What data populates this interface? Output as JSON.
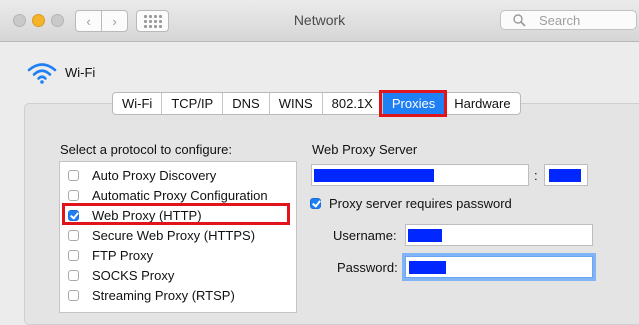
{
  "window": {
    "title": "Network",
    "search_placeholder": "Search"
  },
  "network": {
    "name": "Wi-Fi"
  },
  "tabs": [
    {
      "label": "Wi-Fi",
      "active": false
    },
    {
      "label": "TCP/IP",
      "active": false
    },
    {
      "label": "DNS",
      "active": false
    },
    {
      "label": "WINS",
      "active": false
    },
    {
      "label": "802.1X",
      "active": false
    },
    {
      "label": "Proxies",
      "active": true
    },
    {
      "label": "Hardware",
      "active": false
    }
  ],
  "protocols": {
    "heading": "Select a protocol to configure:",
    "items": [
      {
        "label": "Auto Proxy Discovery",
        "checked": false
      },
      {
        "label": "Automatic Proxy Configuration",
        "checked": false
      },
      {
        "label": "Web Proxy (HTTP)",
        "checked": true,
        "highlighted": true
      },
      {
        "label": "Secure Web Proxy (HTTPS)",
        "checked": false
      },
      {
        "label": "FTP Proxy",
        "checked": false
      },
      {
        "label": "SOCKS Proxy",
        "checked": false
      },
      {
        "label": "Streaming Proxy (RTSP)",
        "checked": false
      }
    ]
  },
  "server": {
    "heading": "Web Proxy Server",
    "colon": ":",
    "requires_password_label": "Proxy server requires password",
    "requires_password": true,
    "username_label": "Username:",
    "password_label": "Password:"
  },
  "colors": {
    "accent": "#1f7ff5",
    "highlight": "#e0151c",
    "redaction": "#0027ff"
  }
}
